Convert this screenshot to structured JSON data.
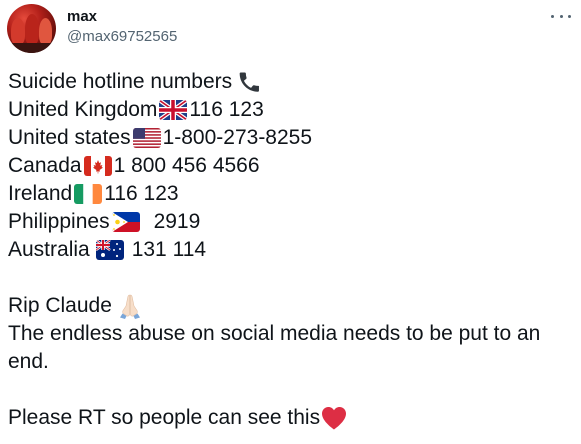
{
  "tweet": {
    "author_name": "max",
    "author_handle": "@max69752565",
    "more_icon": "more-horizontal-icon"
  },
  "body": {
    "heading": "Suicide hotline numbers",
    "heading_icon": "telephone-icon",
    "entries": [
      {
        "country": "United Kingdom",
        "flag": "uk-flag-icon",
        "number": "116 123"
      },
      {
        "country": "United states",
        "flag": "us-flag-icon",
        "number": "1-800-273-8255"
      },
      {
        "country": "Canada",
        "flag": "canada-flag-icon",
        "number": "1 800 456 4566"
      },
      {
        "country": "Ireland",
        "flag": "ireland-flag-icon",
        "number": "116 123"
      },
      {
        "country": "Philippines",
        "flag": "philippines-flag-icon",
        "number": "2919"
      },
      {
        "country": "Australia",
        "flag": "australia-flag-icon",
        "number": "131 114"
      }
    ],
    "rip_text": "Rip Claude",
    "rip_icon": "folded-hands-icon",
    "abuse_text": "The endless abuse on social media needs to be put to an end.",
    "rt_text": "Please RT so people can see this",
    "rt_icon": "red-heart-icon"
  },
  "colors": {
    "text": "#0f1419",
    "secondary": "#536471",
    "heart": "#e0245e"
  }
}
